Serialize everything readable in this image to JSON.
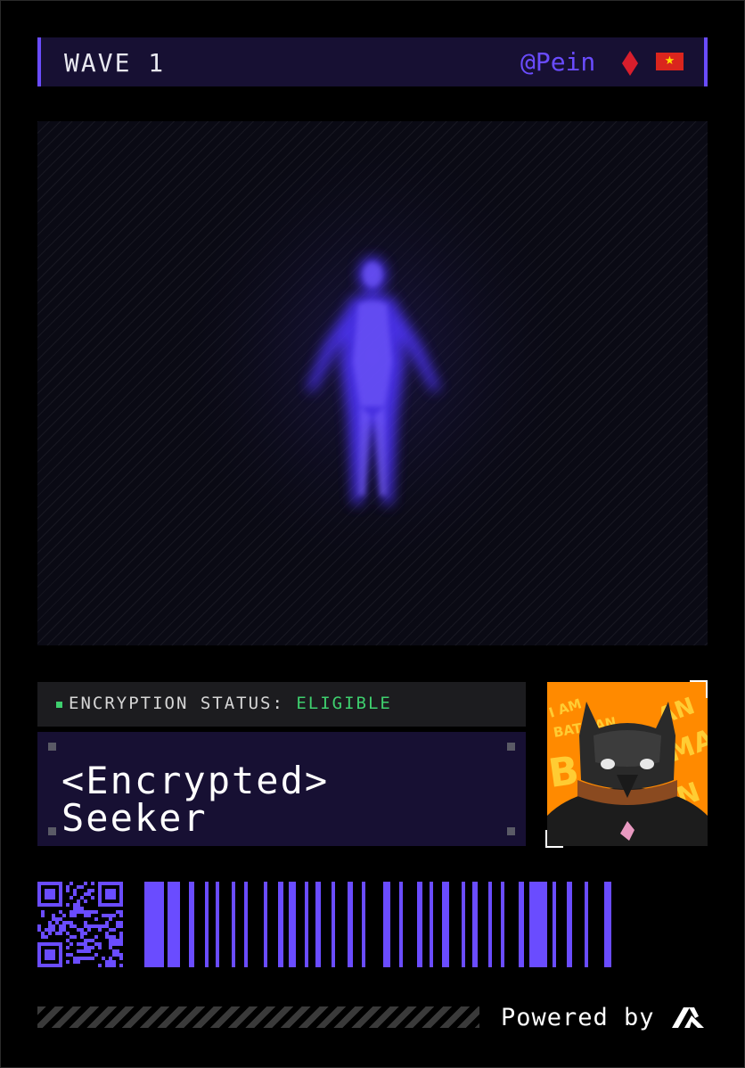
{
  "header": {
    "wave_label": "WAVE 1",
    "handle": "@Pein",
    "diamond_color": "#d81e2c",
    "flag_icon": "vietnam-flag-icon",
    "flag_star": "★",
    "accent": "#6a4cff"
  },
  "hero": {
    "figure_icon": "holographic-human-figure",
    "figure_color": "#5b3cff"
  },
  "status": {
    "label": "ENCRYPTION STATUS:",
    "value": "ELIGIBLE",
    "value_color": "#3ecf6e"
  },
  "card": {
    "name": "<Encrypted>\nSeeker"
  },
  "avatar": {
    "icon": "batman-avatar-image",
    "text": "I AM BATMAN"
  },
  "footer": {
    "powered_by": "Powered by",
    "logo_icon": "brand-logo-icon"
  }
}
